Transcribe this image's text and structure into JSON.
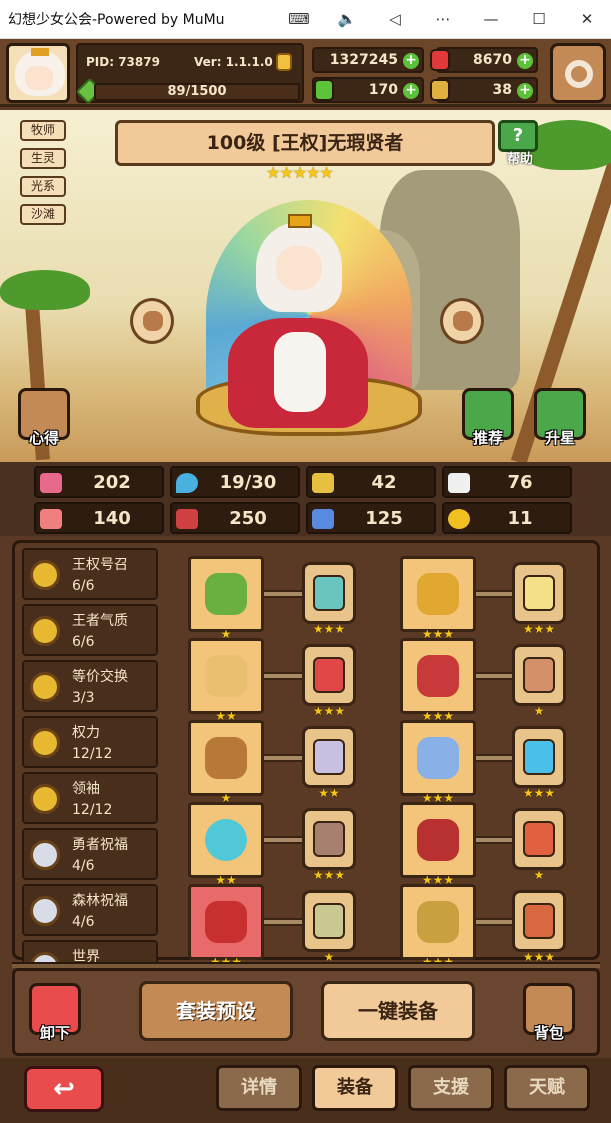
{
  "window": {
    "title": "幻想少女公会-Powered by MuMu"
  },
  "header": {
    "pid": "PID: 73879",
    "ver": "Ver: 1.1.1.0",
    "exp": "89/1500",
    "gold": "1327245",
    "ruby": "8670",
    "clover": "170",
    "key": "38"
  },
  "hero": {
    "tags": [
      "牧师",
      "生灵",
      "光系",
      "沙滩"
    ],
    "name": "100级 [王权]无瑕贤者",
    "stars": "★★★★★",
    "help_label": "帮助",
    "help_glyph": "?",
    "left_btn_label": "心得",
    "recommend_label": "推荐",
    "upgrade_label": "升星"
  },
  "stats": {
    "hp": "202",
    "mana": "19/30",
    "def": "42",
    "speed": "76",
    "atk": "140",
    "magic": "250",
    "skill": "125",
    "luck": "11"
  },
  "skills": [
    {
      "name": "王权号召",
      "count": "6/6"
    },
    {
      "name": "王者气质",
      "count": "6/6"
    },
    {
      "name": "等价交换",
      "count": "3/3"
    },
    {
      "name": "权力",
      "count": "12/12"
    },
    {
      "name": "领袖",
      "count": "12/12"
    },
    {
      "name": "勇者祝福",
      "count": "4/6"
    },
    {
      "name": "森林祝福",
      "count": "4/6"
    },
    {
      "name": "世界",
      "count": ""
    }
  ],
  "equipment": {
    "rows": [
      {
        "left": {
          "item_stars": "★",
          "gem_stars": "★★★"
        },
        "right": {
          "item_stars": "★★★",
          "gem_stars": "★★★"
        }
      },
      {
        "left": {
          "item_stars": "★★",
          "gem_stars": "★★★"
        },
        "right": {
          "item_stars": "★★★",
          "gem_stars": "★"
        }
      },
      {
        "left": {
          "item_stars": "★",
          "gem_stars": "★★"
        },
        "right": {
          "item_stars": "★★★",
          "gem_stars": "★★★"
        }
      },
      {
        "left": {
          "item_stars": "★★",
          "gem_stars": "★★★"
        },
        "right": {
          "item_stars": "★★★",
          "gem_stars": "★"
        }
      },
      {
        "left": {
          "item_stars": "★★★",
          "gem_stars": "★"
        },
        "right": {
          "item_stars": "★★★",
          "gem_stars": "★★★"
        }
      }
    ]
  },
  "actions": {
    "unequip": "卸下",
    "preset": "套装预设",
    "auto_equip": "一键装备",
    "bag": "背包"
  },
  "nav": {
    "back_glyph": "↩",
    "tabs": [
      "详情",
      "装备",
      "支援",
      "天赋"
    ],
    "active": "装备"
  },
  "colors": {
    "gold": "#f0c040",
    "ruby": "#e03a3a",
    "clover": "#5cc23a",
    "key": "#e0b040",
    "hp": "#e86a8a",
    "mana": "#4ab0e0"
  }
}
